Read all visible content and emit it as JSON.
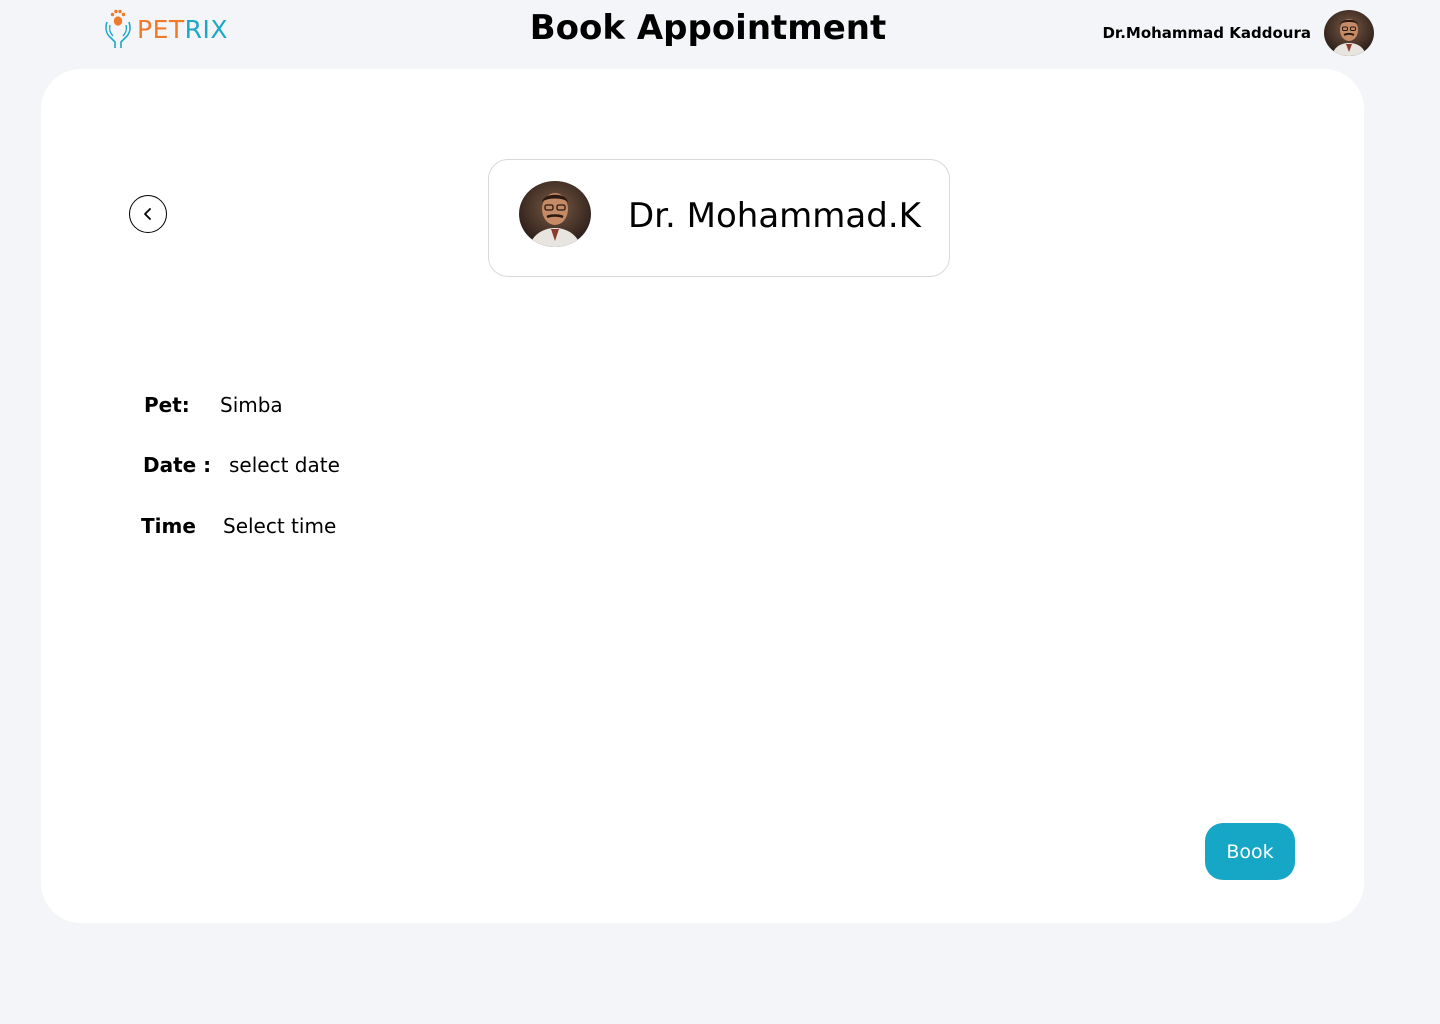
{
  "header": {
    "logo_part1": "PET",
    "logo_part2": "RIX",
    "title": "Book Appointment",
    "user_name": "Dr.Mohammad Kaddoura"
  },
  "doctor": {
    "name": "Dr. Mohammad.K"
  },
  "form": {
    "pet_label": "Pet:",
    "pet_value": "Simba",
    "date_label": "Date :",
    "date_value": "select date",
    "time_label": "Time",
    "time_value": "Select time"
  },
  "actions": {
    "book_label": "Book"
  },
  "colors": {
    "accent": "#17a7c6",
    "logo_orange": "#f07a2a",
    "logo_blue": "#1da7c8",
    "background": "#f4f5f9"
  },
  "icons": {
    "back": "chevron-left-icon",
    "logo": "paw-hands-icon"
  }
}
